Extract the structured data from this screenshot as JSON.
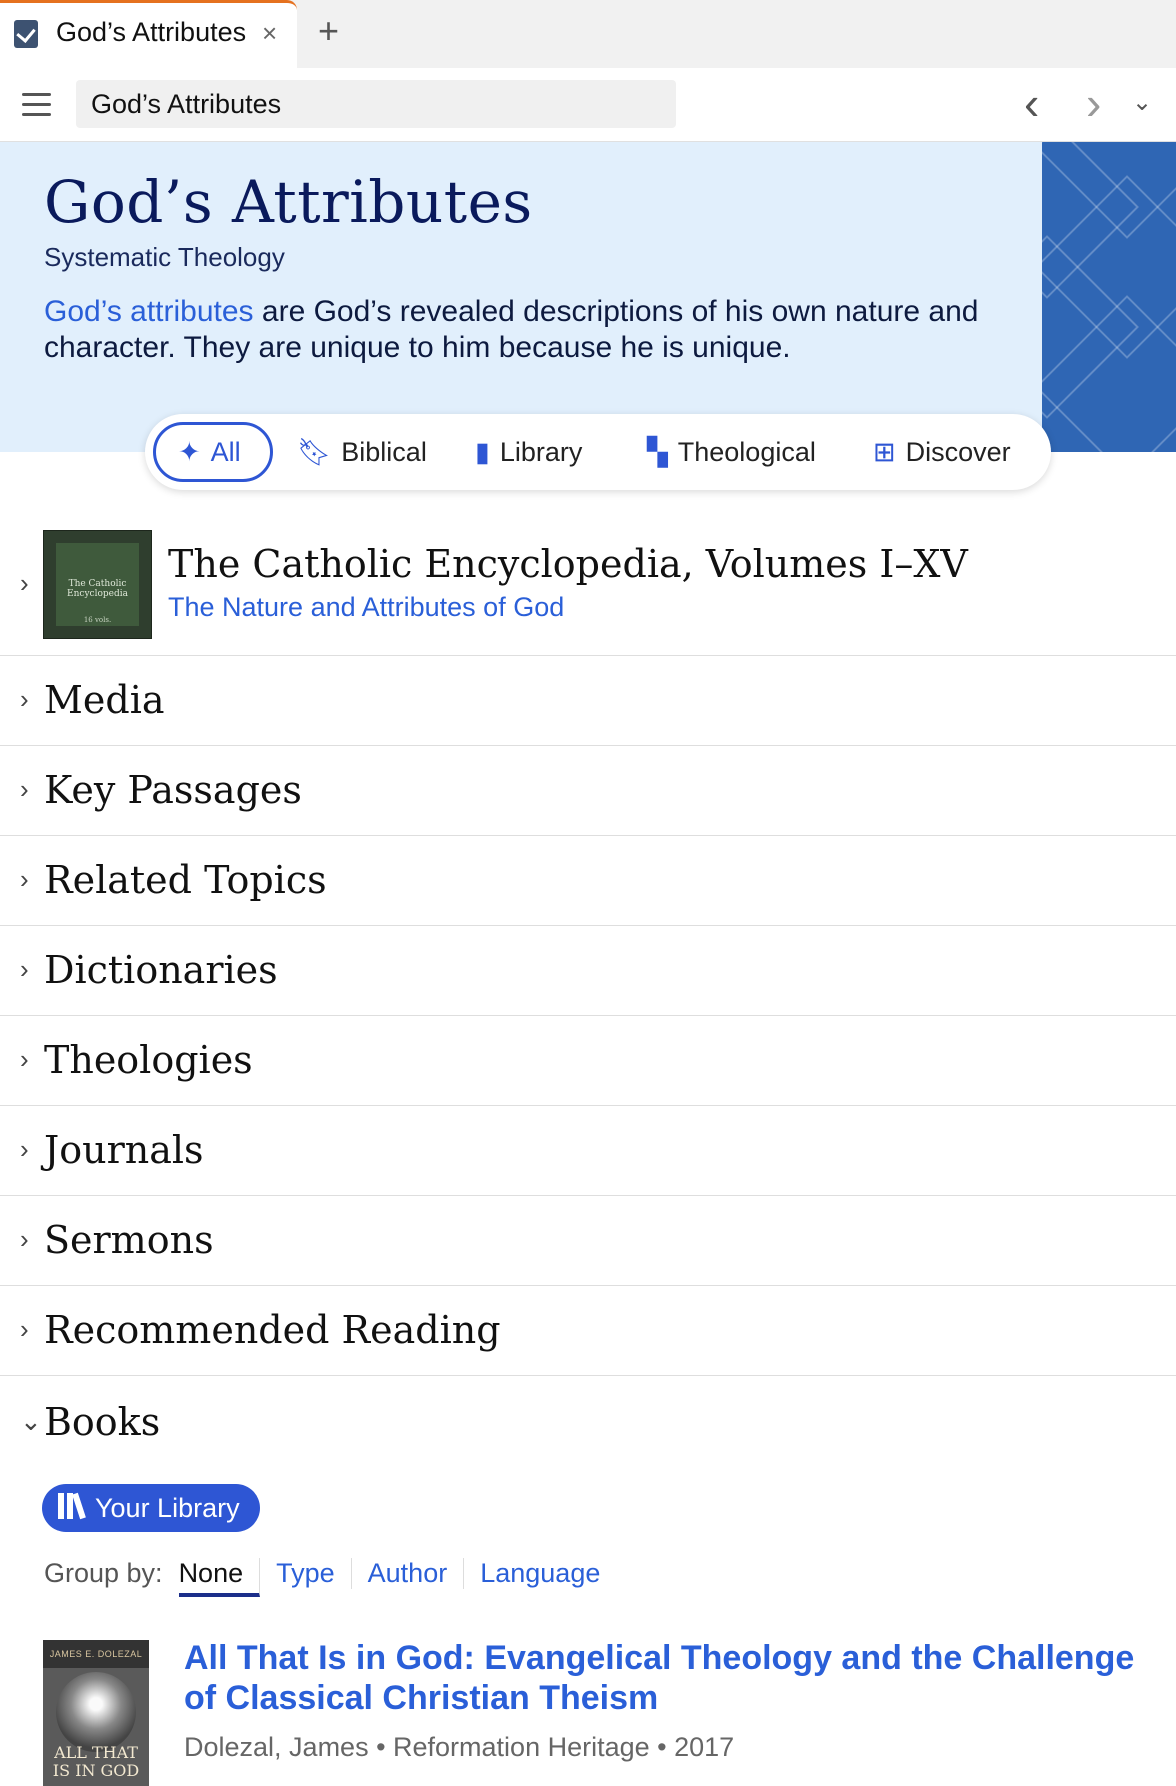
{
  "tab": {
    "title": "God’s Attributes",
    "close": "×",
    "new_tab": "+"
  },
  "toolbar": {
    "address": "God’s Attributes",
    "back": "‹",
    "forward": "›",
    "dropdown": "⌄"
  },
  "hero": {
    "title": "God’s Attributes",
    "subtitle": "Systematic Theology",
    "desc_link": "God’s attributes",
    "desc_rest": " are God’s revealed descriptions of his own nature and character. They are unique to him because he is unique."
  },
  "filters": [
    {
      "label": "All",
      "icon": "sparkle-icon",
      "active": true
    },
    {
      "label": "Biblical",
      "icon": "bookmark-icon"
    },
    {
      "label": "Library",
      "icon": "book-icon"
    },
    {
      "label": "Theological",
      "icon": "blocks-icon"
    },
    {
      "label": "Discover",
      "icon": "discover-icon"
    }
  ],
  "featured": {
    "title": "The Catholic Encyclopedia, Volumes I–XV",
    "subtitle": "The Nature and Attributes of God",
    "cover_text": "The Catholic Encyclopedia",
    "cover_vols": "16 vols."
  },
  "sections": [
    "Media",
    "Key Passages",
    "Related Topics",
    "Dictionaries",
    "Theologies",
    "Journals",
    "Sermons",
    "Recommended Reading"
  ],
  "books": {
    "heading": "Books",
    "library_button": "Your Library",
    "group_by_label": "Group by:",
    "group_by_options": [
      "None",
      "Type",
      "Author",
      "Language"
    ],
    "entry": {
      "cover_author": "JAMES E. DOLEZAL",
      "cover_title": "ALL THAT IS IN GOD",
      "title": "All That Is in God: Evangelical Theology and the Challenge of Classical Christian Theism",
      "meta": "Dolezal, James • Reformation Heritage • 2017"
    }
  },
  "colors": {
    "accent": "#2e56d4",
    "link": "#2a5fd8",
    "hero_bg": "#e1effc",
    "tab_accent": "#e5711f"
  }
}
